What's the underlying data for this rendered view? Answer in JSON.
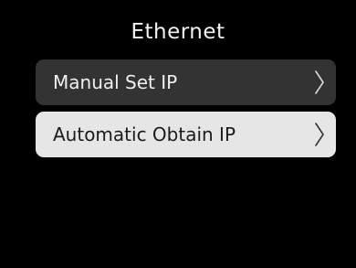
{
  "header": {
    "title": "Ethernet"
  },
  "menu": {
    "items": [
      {
        "label": "Manual Set IP",
        "icon": "chevron-right-icon",
        "state": "default"
      },
      {
        "label": "Automatic Obtain IP",
        "icon": "chevron-right-icon",
        "state": "selected"
      }
    ]
  },
  "colors": {
    "background": "#000000",
    "item_default": "#333333",
    "item_selected": "#e6e6e6",
    "text_light": "#f0f0f0",
    "text_dark": "#1a1a1a"
  }
}
